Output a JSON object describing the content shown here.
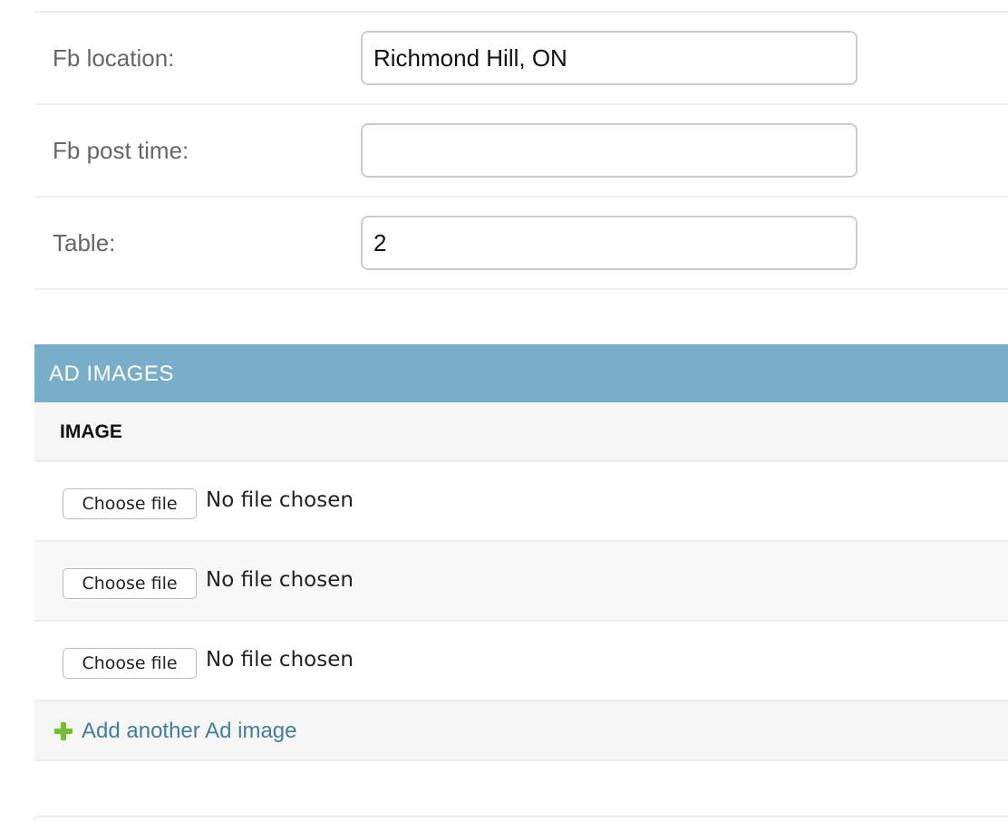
{
  "fields": [
    {
      "label": "Fb location:",
      "value": "Richmond Hill, ON"
    },
    {
      "label": "Fb post time:",
      "value": ""
    },
    {
      "label": "Table:",
      "value": "2"
    }
  ],
  "inline": {
    "title": "AD IMAGES",
    "column_header": "IMAGE",
    "rows": [
      {
        "button_label": "Choose file",
        "status": "No file chosen"
      },
      {
        "button_label": "Choose file",
        "status": "No file chosen"
      },
      {
        "button_label": "Choose file",
        "status": "No file chosen"
      }
    ],
    "add_link_label": "Add another Ad image",
    "add_icon": "plus-icon"
  },
  "colors": {
    "section_header": "#79aec8",
    "link": "#447e9b",
    "add_icon": "#70bf2b"
  }
}
